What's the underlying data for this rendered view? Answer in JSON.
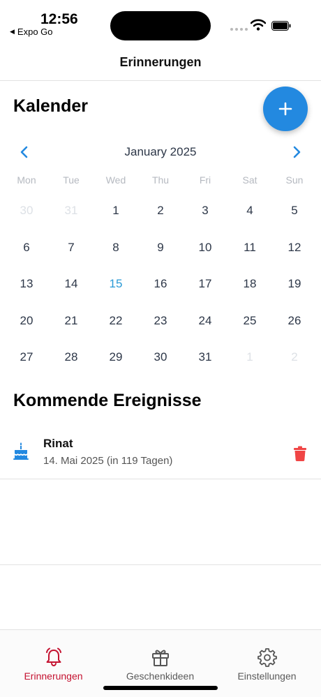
{
  "status_bar": {
    "time": "12:56",
    "back_app_label": "Expo Go"
  },
  "header": {
    "title": "Erinnerungen"
  },
  "calendar": {
    "section_title": "Kalender",
    "month_label": "January 2025",
    "weekdays": [
      "Mon",
      "Tue",
      "Wed",
      "Thu",
      "Fri",
      "Sat",
      "Sun"
    ],
    "days": [
      {
        "label": "30",
        "state": "muted"
      },
      {
        "label": "31",
        "state": "muted"
      },
      {
        "label": "1",
        "state": "normal"
      },
      {
        "label": "2",
        "state": "normal"
      },
      {
        "label": "3",
        "state": "normal"
      },
      {
        "label": "4",
        "state": "normal"
      },
      {
        "label": "5",
        "state": "normal"
      },
      {
        "label": "6",
        "state": "normal"
      },
      {
        "label": "7",
        "state": "normal"
      },
      {
        "label": "8",
        "state": "normal"
      },
      {
        "label": "9",
        "state": "normal"
      },
      {
        "label": "10",
        "state": "normal"
      },
      {
        "label": "11",
        "state": "normal"
      },
      {
        "label": "12",
        "state": "normal"
      },
      {
        "label": "13",
        "state": "normal"
      },
      {
        "label": "14",
        "state": "normal"
      },
      {
        "label": "15",
        "state": "today"
      },
      {
        "label": "16",
        "state": "normal"
      },
      {
        "label": "17",
        "state": "normal"
      },
      {
        "label": "18",
        "state": "normal"
      },
      {
        "label": "19",
        "state": "normal"
      },
      {
        "label": "20",
        "state": "normal"
      },
      {
        "label": "21",
        "state": "normal"
      },
      {
        "label": "22",
        "state": "normal"
      },
      {
        "label": "23",
        "state": "normal"
      },
      {
        "label": "24",
        "state": "normal"
      },
      {
        "label": "25",
        "state": "normal"
      },
      {
        "label": "26",
        "state": "normal"
      },
      {
        "label": "27",
        "state": "normal"
      },
      {
        "label": "28",
        "state": "normal"
      },
      {
        "label": "29",
        "state": "normal"
      },
      {
        "label": "30",
        "state": "normal"
      },
      {
        "label": "31",
        "state": "normal"
      },
      {
        "label": "1",
        "state": "muted"
      },
      {
        "label": "2",
        "state": "muted"
      }
    ]
  },
  "events": {
    "section_title": "Kommende Ereignisse",
    "items": [
      {
        "name": "Rinat",
        "date": "14. Mai 2025 (in 119 Tagen)",
        "icon": "birthday-cake-icon"
      }
    ]
  },
  "tabs": [
    {
      "label": "Erinnerungen",
      "icon": "bell-icon",
      "active": true
    },
    {
      "label": "Geschenkideen",
      "icon": "gift-icon",
      "active": false
    },
    {
      "label": "Einstellungen",
      "icon": "gear-icon",
      "active": false
    }
  ],
  "colors": {
    "accent": "#2389e0",
    "today": "#2a9ad6",
    "active_tab": "#c41230",
    "delete": "#f04545"
  }
}
